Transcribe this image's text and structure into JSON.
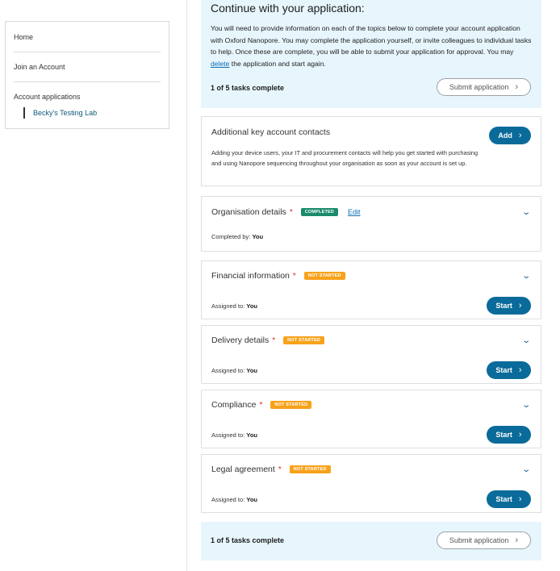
{
  "sidebar": {
    "home": "Home",
    "join": "Join an Account",
    "applications": "Account applications",
    "current_app": "Becky's Testing Lab"
  },
  "intro": {
    "title": "Continue with your application:",
    "body_1": "You will need to provide information on each of the topics below to complete your account application with Oxford Nanopore. You may complete the application yourself, or invite colleagues to individual tasks to help. Once these are complete, you will be able to submit your application for approval. You may ",
    "delete_link": "delete",
    "body_2": " the application and start again.",
    "progress": "1 of 5 tasks complete",
    "submit": "Submit application"
  },
  "contacts": {
    "title": "Additional key account contacts",
    "desc": "Adding your device users, your IT and procurement contacts will help you get started with purchasing and using Nanopore sequencing throughout your organisation as soon as your account is set up.",
    "add": "Add"
  },
  "tasks": [
    {
      "title": "Organisation details",
      "required": "*",
      "status": "COMPLETED",
      "edit": "Edit",
      "meta_label": "Completed by:",
      "meta_value": "You"
    },
    {
      "title": "Financial information",
      "required": "*",
      "status": "NOT STARTED",
      "meta_label": "Assigned to:",
      "meta_value": "You",
      "action": "Start"
    },
    {
      "title": "Delivery details",
      "required": "*",
      "status": "NOT STARTED",
      "meta_label": "Assigned to:",
      "meta_value": "You",
      "action": "Start"
    },
    {
      "title": "Compliance",
      "required": "*",
      "status": "NOT STARTED",
      "meta_label": "Assigned to:",
      "meta_value": "You",
      "action": "Start"
    },
    {
      "title": "Legal agreement",
      "required": "*",
      "status": "NOT STARTED",
      "meta_label": "Assigned to:",
      "meta_value": "You",
      "action": "Start"
    }
  ],
  "footer": {
    "progress": "1 of 5 tasks complete",
    "submit": "Submit application"
  },
  "icons": {
    "chevron_right": "chevron-right-icon",
    "chevron_down": "chevron-down-icon"
  },
  "colors": {
    "primary": "#0a6b9a",
    "panel_bg": "#e7f6fd",
    "completed": "#1a8a6b",
    "not_started": "#f7a21b",
    "required": "#d32f2f"
  }
}
